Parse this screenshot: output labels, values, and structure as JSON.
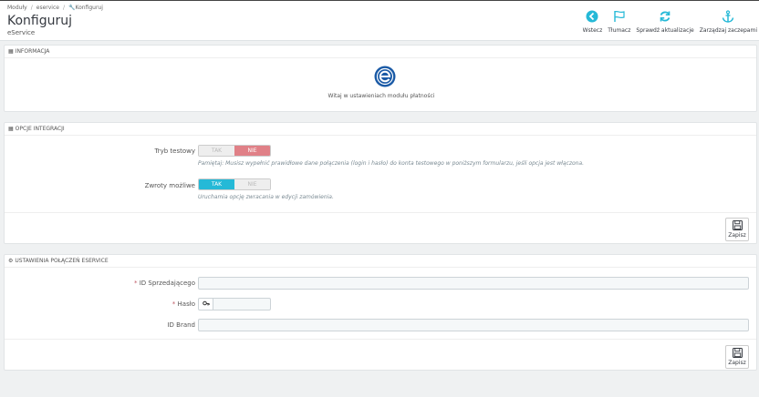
{
  "breadcrumb": {
    "item1": "Moduły",
    "item2": "eservice",
    "item3": "Konfiguruj"
  },
  "header": {
    "title": "Konfiguruj",
    "subtitle": "eService"
  },
  "toolbar": {
    "back": "Wstecz",
    "translate": "Tłumacz",
    "check_updates": "Sprawdź aktualizacje",
    "manage_hooks": "Zarządzaj zaczepami"
  },
  "info_panel": {
    "heading": "INFORMACJA",
    "welcome": "Witaj w ustawieniach modułu płatności"
  },
  "integration_panel": {
    "heading": "OPCJE INTEGRACJI",
    "test_mode": {
      "label": "Tryb testowy",
      "yes": "TAK",
      "no": "NIE",
      "help": "Pamiętaj: Musisz wypełnić prawidłowe dane połączenia (login i hasło) do konta testowego w poniższym formularzu, jeśli opcja jest włączona."
    },
    "refunds": {
      "label": "Zwroty możliwe",
      "yes": "TAK",
      "no": "NIE",
      "help": "Uruchamia opcję zwracania w edycji zamówienia."
    },
    "save": "Zapisz"
  },
  "connection_panel": {
    "heading": "USTAWIENIA POŁĄCZEŃ ESERVICE",
    "merchant_id_label": "ID Sprzedającego",
    "password_label": "Hasło",
    "brand_id_label": "ID Brand",
    "required_mark": "*",
    "save": "Zapisz"
  },
  "colors": {
    "accent": "#25b9d7",
    "no_active": "#e08087",
    "logo": "#1a5aa6"
  }
}
